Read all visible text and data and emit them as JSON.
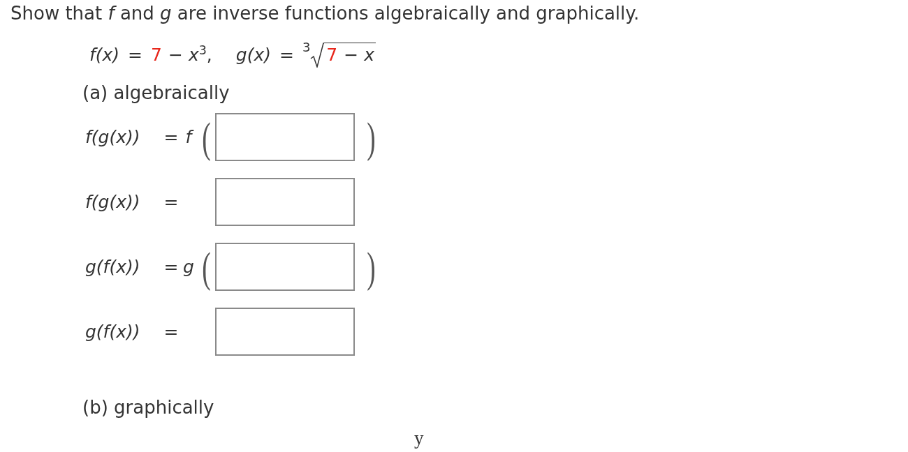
{
  "title": "Show that *f* and *g* are inverse functions algebraically and graphically.",
  "given": [
    {
      "kind": "polynomial",
      "lhs": "f(x)",
      "eq": "=",
      "terms": [
        {
          "text": "7",
          "highlight": true
        },
        {
          "text": "− *x*$^{3}$,",
          "highlight": false
        }
      ]
    },
    {
      "kind": "cube_root",
      "lhs": "g(x)",
      "eq": "=",
      "index": "3",
      "terms": [
        {
          "text": "7",
          "highlight": true
        },
        {
          "text": "− *x*",
          "highlight": false
        }
      ]
    }
  ],
  "part_a": {
    "heading": "(a) algebraically",
    "rows": [
      {
        "kind": "wrapped",
        "label": "f(g(x))",
        "eq": "=",
        "outer": "f",
        "open": "(",
        "close": ")"
      },
      {
        "kind": "plain",
        "label": "f(g(x))",
        "eq": "="
      },
      {
        "kind": "wrapped",
        "label": "g(f(x))",
        "eq": "=",
        "outer": "g",
        "open": "(",
        "close": ")"
      },
      {
        "kind": "plain",
        "label": "g(f(x))",
        "eq": "="
      }
    ]
  },
  "part_b": {
    "heading": "(b) graphically",
    "graph": {
      "axis_label": "y"
    }
  }
}
